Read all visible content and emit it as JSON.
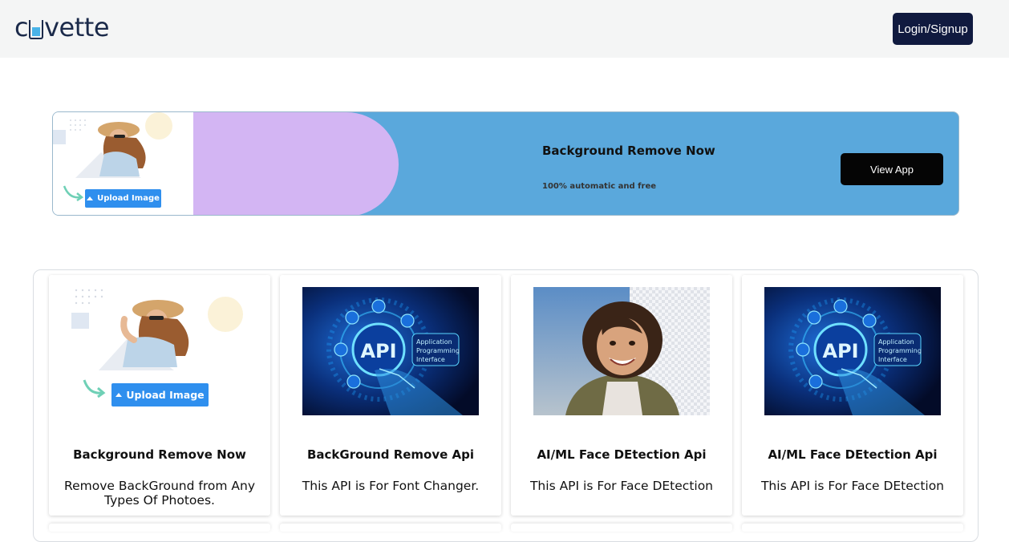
{
  "header": {
    "logo_text_start": "c",
    "logo_text_end": "vette",
    "login_label": "Login/Signup"
  },
  "banner": {
    "title": "Background Remove Now",
    "subtitle": "100% automatic and free",
    "button_label": "View App",
    "upload_label": "Upload Image",
    "colors": {
      "background": "#5aa8dc",
      "accent": "#d3b5f3"
    }
  },
  "cards": [
    {
      "title": "Background Remove Now",
      "description": "Remove BackGround from Any Types Of Photoes.",
      "image": "upload-illustration",
      "upload_label": "Upload Image"
    },
    {
      "title": "BackGround Remove Api",
      "description": "This API is For Font Changer.",
      "image": "api-illustration",
      "api_text": "API",
      "api_caption": "Application Programming Interface"
    },
    {
      "title": "AI/ML Face DEtection Api",
      "description": "This API is For Face DEtection",
      "image": "child-photo"
    },
    {
      "title": "AI/ML Face DEtection Api",
      "description": "This API is For Face DEtection",
      "image": "api-illustration",
      "api_text": "API",
      "api_caption": "Application Programming Interface"
    }
  ]
}
